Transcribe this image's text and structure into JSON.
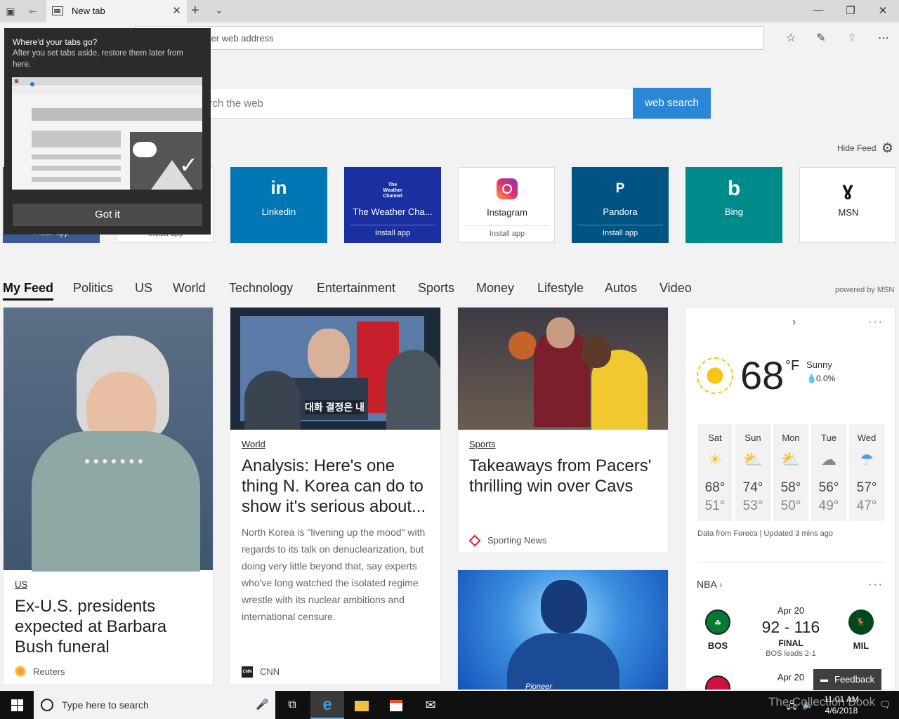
{
  "browser": {
    "tab_title": "New tab",
    "address_placeholder": "Search or enter web address",
    "address_visible_text": "ter web address"
  },
  "popup": {
    "title": "Where'd your tabs go?",
    "body": "After you set tabs aside, restore them later from here.",
    "button": "Got it"
  },
  "search": {
    "placeholder_visible": "arch the web",
    "button": "web search"
  },
  "feed_controls": {
    "hide_feed": "Hide Feed",
    "powered_by": "powered by MSN"
  },
  "tiles": [
    {
      "label": "",
      "install": "Install app",
      "color": "#3b5998"
    },
    {
      "label": "",
      "install": "Install app",
      "color": "#ffffff"
    },
    {
      "label": "Linkedin",
      "glyph": "in",
      "install": "",
      "color": "#0077b5"
    },
    {
      "label": "The Weather Cha...",
      "glyph": "The Weather Channel",
      "install": "Install app",
      "color": "#1a2fa0"
    },
    {
      "label": "Instagram",
      "glyph": "instagram-icon",
      "install": "Install app",
      "color": "#ffffff"
    },
    {
      "label": "Pandora",
      "glyph": "P",
      "install": "Install app",
      "color": "#005483"
    },
    {
      "label": "Bing",
      "glyph": "bing-icon",
      "install": "",
      "color": "#008b8b"
    },
    {
      "label": "MSN",
      "glyph": "msn-icon",
      "install": "",
      "color": "#ffffff"
    }
  ],
  "nav": [
    "My Feed",
    "Politics",
    "US",
    "World",
    "Technology",
    "Entertainment",
    "Sports",
    "Money",
    "Lifestyle",
    "Autos",
    "Video"
  ],
  "articles": [
    {
      "category": "US",
      "headline": "Ex-U.S. presidents expected at Barbara Bush funeral",
      "source": "Reuters"
    },
    {
      "category": "World",
      "headline": "Analysis: Here's one thing N. Korea can do to show it's serious about...",
      "summary": "North Korea is \"livening up the mood\" with regards to its talk on denuclearization, but doing very little beyond that, say experts who've long watched the isolated regime wrestle with its nuclear ambitions and international censure.",
      "source": "CNN",
      "image_caption": "대화 결정은 내"
    },
    {
      "category": "Sports",
      "headline": "Takeaways from Pacers' thrilling win over Cavs",
      "source": "Sporting News"
    },
    {
      "image_text": "Pioneer"
    }
  ],
  "weather": {
    "temp": "68",
    "unit": "°F",
    "condition": "Sunny",
    "precip": "0.0%",
    "forecast": [
      {
        "day": "Sat",
        "hi": "68°",
        "lo": "51°",
        "icon": "sun-icon"
      },
      {
        "day": "Sun",
        "hi": "74°",
        "lo": "53°",
        "icon": "partly-sunny-icon"
      },
      {
        "day": "Mon",
        "hi": "58°",
        "lo": "50°",
        "icon": "partly-sunny-icon"
      },
      {
        "day": "Tue",
        "hi": "56°",
        "lo": "49°",
        "icon": "cloud-icon"
      },
      {
        "day": "Wed",
        "hi": "57°",
        "lo": "47°",
        "icon": "rain-icon"
      }
    ],
    "data_source": "Data from Foreca | Updated 3 mins ago"
  },
  "nba": {
    "title": "NBA",
    "game1": {
      "date": "Apr 20",
      "score": "92 - 116",
      "status": "FINAL",
      "series": "BOS leads 2-1",
      "home": "BOS",
      "away": "MIL",
      "home_color": "#007a33",
      "away_color": "#00471b"
    },
    "game2": {
      "date": "Apr 20"
    }
  },
  "feedback": "Feedback",
  "taskbar": {
    "search_placeholder": "Type here to search",
    "time": "11:01 AM",
    "date": "4/6/2018",
    "watermark": "The Collection Book"
  }
}
